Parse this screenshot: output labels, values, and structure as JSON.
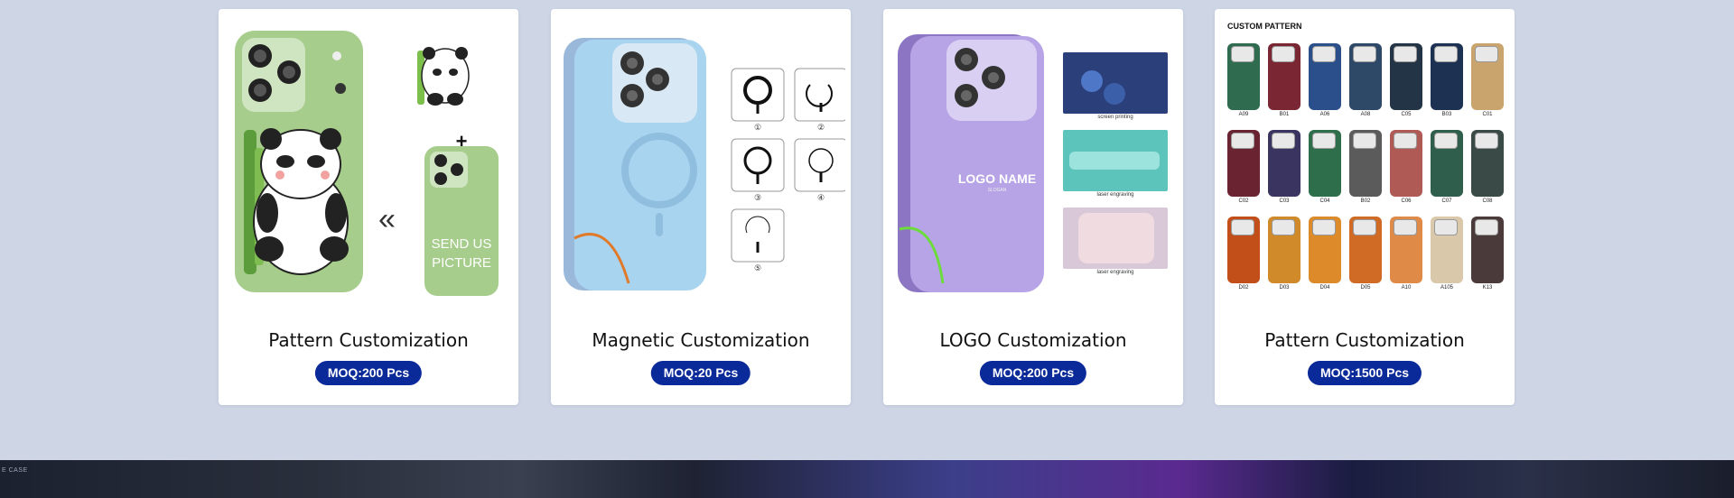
{
  "cards": [
    {
      "title": "Pattern Customization",
      "moq": "MOQ:200 Pcs",
      "image_text": {
        "send_us_line1": "SEND US",
        "send_us_line2": "PICTURE",
        "plus": "+",
        "arrows": "«"
      }
    },
    {
      "title": "Magnetic Customization",
      "moq": "MOQ:20 Pcs",
      "image_text": {
        "options": [
          "①",
          "②",
          "③",
          "④",
          "⑤"
        ]
      }
    },
    {
      "title": "LOGO Customization",
      "moq": "MOQ:200 Pcs",
      "image_text": {
        "logo_name": "LOGO NAME",
        "logo_sub": "SLOGAN",
        "samples": [
          "screen printing",
          "laser engraving",
          "laser engraving"
        ]
      }
    },
    {
      "title": "Pattern Customization",
      "moq": "MOQ:1500 Pcs",
      "image_text": {
        "heading": "CUSTOM PATTERN",
        "row1": [
          "A09",
          "B01",
          "A06",
          "A08",
          "C05",
          "B03",
          "C01"
        ],
        "row2": [
          "C02",
          "C03",
          "C04",
          "B02",
          "C06",
          "C07",
          "C08"
        ],
        "row3": [
          "D02",
          "D03",
          "D04",
          "D05",
          "A10",
          "A105",
          "K13"
        ]
      }
    }
  ],
  "banner": {
    "text": "E CASE",
    "subtext": ""
  },
  "colors": {
    "background": "#ced6e6",
    "badge": "#0b2a99",
    "card": "#ffffff"
  }
}
